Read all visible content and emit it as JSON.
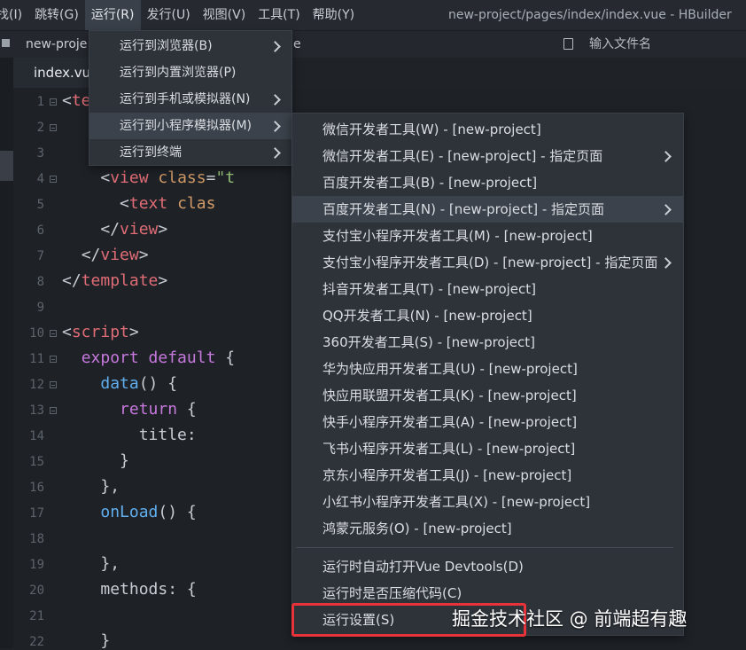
{
  "menubar": {
    "items": [
      "找(I)",
      "跳转(G)",
      "运行(R)",
      "发行(U)",
      "视图(V)",
      "工具(T)",
      "帮助(Y)"
    ],
    "window_title": "new-project/pages/index/index.vue - HBuilder"
  },
  "toolbar": {
    "project_tab": "new-proje",
    "fragment": "e",
    "file_search_placeholder": "输入文件名",
    "file_icon": "file-search-icon"
  },
  "editor": {
    "tab_label": "index.vu",
    "line_numbers": [
      "1",
      "2",
      "3",
      "4",
      "5",
      "6",
      "7",
      "8",
      "9",
      "10",
      "11",
      "12",
      "13",
      "14",
      "15",
      "16",
      "17",
      "18",
      "19",
      "20",
      "21",
      "22"
    ]
  },
  "run_menu": {
    "items": [
      {
        "label": "运行到浏览器(B)",
        "has_submenu": true
      },
      {
        "label": "运行到内置浏览器(P)",
        "has_submenu": false
      },
      {
        "label": "运行到手机或模拟器(N)",
        "has_submenu": true
      },
      {
        "label": "运行到小程序模拟器(M)",
        "has_submenu": true
      },
      {
        "label": "运行到终端",
        "has_submenu": true
      }
    ]
  },
  "miniprogram_menu": {
    "items": [
      {
        "label": "微信开发者工具(W) - [new-project]",
        "has_submenu": false
      },
      {
        "label": "微信开发者工具(E) - [new-project] - 指定页面",
        "has_submenu": true
      },
      {
        "label": "百度开发者工具(B) - [new-project]",
        "has_submenu": false
      },
      {
        "label": "百度开发者工具(N) - [new-project] - 指定页面",
        "has_submenu": true
      },
      {
        "label": "支付宝小程序开发者工具(M) - [new-project]",
        "has_submenu": false
      },
      {
        "label": "支付宝小程序开发者工具(D) - [new-project] - 指定页面",
        "has_submenu": true
      },
      {
        "label": "抖音开发者工具(T) - [new-project]",
        "has_submenu": false
      },
      {
        "label": "QQ开发者工具(N) - [new-project]",
        "has_submenu": false
      },
      {
        "label": "360开发者工具(S) - [new-project]",
        "has_submenu": false
      },
      {
        "label": "华为快应用开发者工具(U) - [new-project]",
        "has_submenu": false
      },
      {
        "label": "快应用联盟开发者工具(K) - [new-project]",
        "has_submenu": false
      },
      {
        "label": "快手小程序开发者工具(A) - [new-project]",
        "has_submenu": false
      },
      {
        "label": "飞书小程序开发者工具(L) - [new-project]",
        "has_submenu": false
      },
      {
        "label": "京东小程序开发者工具(J) - [new-project]",
        "has_submenu": false
      },
      {
        "label": "小红书小程序开发者工具(X) - [new-project]",
        "has_submenu": false
      },
      {
        "label": "鸿蒙元服务(O) - [new-project]",
        "has_submenu": false
      }
    ],
    "extra_items": [
      {
        "label": "运行时自动打开Vue Devtools(D)"
      },
      {
        "label": "运行时是否压缩代码(C)"
      },
      {
        "label": "运行设置(S)"
      }
    ]
  },
  "watermark": "掘金技术社区 @ 前端超有趣",
  "colors": {
    "highlight_box": "#e8333a",
    "tag": "#e06c75",
    "keyword": "#c678dd",
    "function": "#61afef",
    "attribute": "#d19a66"
  }
}
